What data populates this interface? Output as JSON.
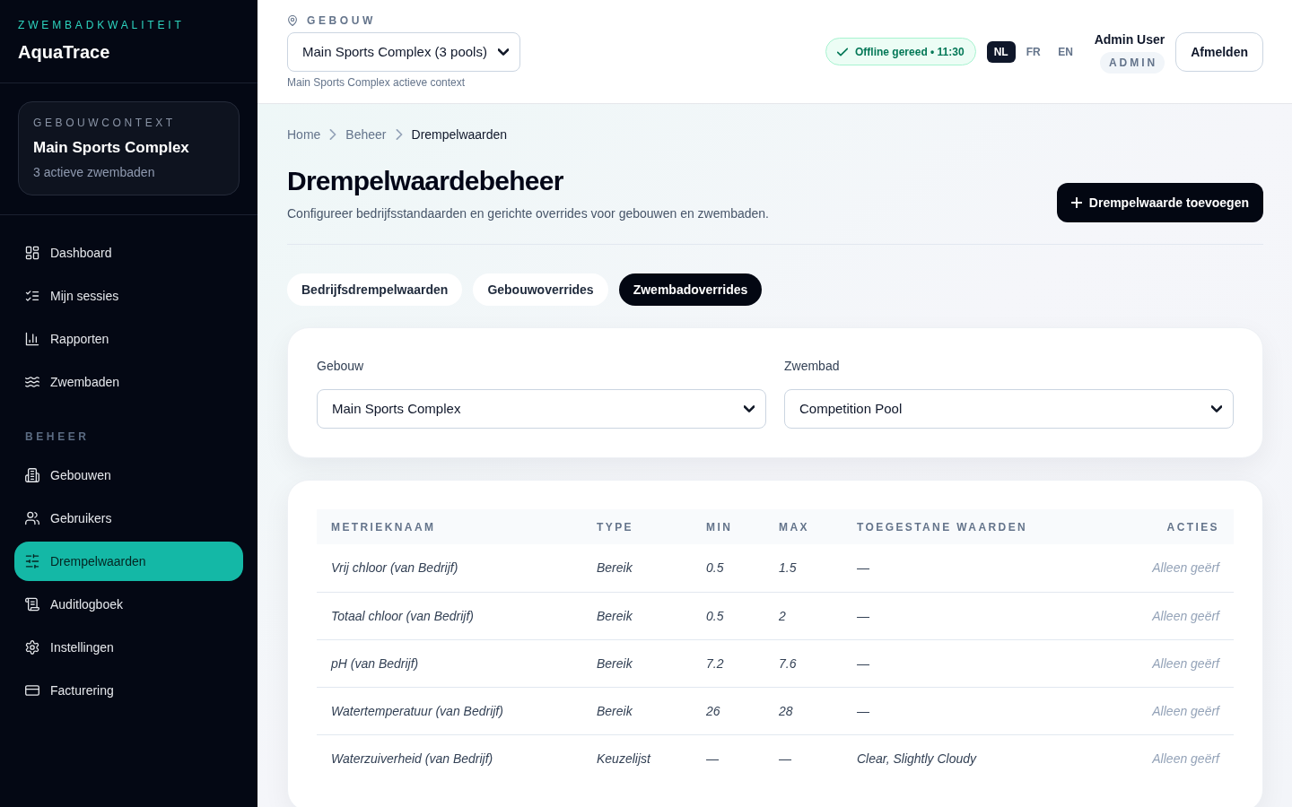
{
  "sidebar": {
    "eyebrow": "ZWEMBADKWALITEIT",
    "brand": "AquaTrace",
    "context_card": {
      "label": "GEBOUWCONTEXT",
      "title": "Main Sports Complex",
      "subtitle": "3 actieve zwembaden"
    },
    "sections": [
      {
        "items": [
          {
            "label": "Dashboard",
            "selected": false
          },
          {
            "label": "Mijn sessies",
            "selected": false
          },
          {
            "label": "Rapporten",
            "selected": false
          },
          {
            "label": "Zwembaden",
            "selected": false
          }
        ]
      },
      {
        "title": "BEHEER",
        "items": [
          {
            "label": "Gebouwen",
            "selected": false
          },
          {
            "label": "Gebruikers",
            "selected": false
          },
          {
            "label": "Drempelwaarden",
            "selected": true
          },
          {
            "label": "Auditlogboek",
            "selected": false
          },
          {
            "label": "Instellingen",
            "selected": false
          },
          {
            "label": "Facturering",
            "selected": false
          }
        ]
      }
    ]
  },
  "header": {
    "building_label": "GEBOUW",
    "building_select": {
      "value": "Main Sports Complex (3 pools)"
    },
    "building_hint": "Main Sports Complex actieve context",
    "sync_badge": "Offline gereed • 11:30",
    "languages": [
      {
        "label": "NL",
        "selected": true
      },
      {
        "label": "FR",
        "selected": false
      },
      {
        "label": "EN",
        "selected": false
      }
    ],
    "user": {
      "name": "Admin User",
      "role": "ADMIN"
    },
    "logout_button": "Afmelden"
  },
  "breadcrumb": [
    "Home",
    "Beheer",
    "Drempelwaarden"
  ],
  "page": {
    "title": "Drempelwaardebeheer",
    "subtitle": "Configureer bedrijfsstandaarden en gerichte overrides voor gebouwen en zwembaden.",
    "add_button": "Drempelwaarde toevoegen"
  },
  "tabs": [
    {
      "label": "Bedrijfsdrempelwaarden",
      "selected": false
    },
    {
      "label": "Gebouwoverrides",
      "selected": false
    },
    {
      "label": "Zwembadoverrides",
      "selected": true
    }
  ],
  "filters": [
    {
      "label": "Gebouw",
      "value": "Main Sports Complex"
    },
    {
      "label": "Zwembad",
      "value": "Competition Pool"
    }
  ],
  "table": {
    "columns": [
      "METRIEKNAAM",
      "TYPE",
      "MIN",
      "MAX",
      "TOEGESTANE WAARDEN",
      "ACTIES"
    ],
    "rows": [
      [
        "Vrij chloor (van Bedrijf)",
        "Bereik",
        "0.5",
        "1.5",
        "—",
        "Alleen geërf"
      ],
      [
        "Totaal chloor (van Bedrijf)",
        "Bereik",
        "0.5",
        "2",
        "—",
        "Alleen geërf"
      ],
      [
        "pH (van Bedrijf)",
        "Bereik",
        "7.2",
        "7.6",
        "—",
        "Alleen geërf"
      ],
      [
        "Watertemperatuur (van Bedrijf)",
        "Bereik",
        "26",
        "28",
        "—",
        "Alleen geërf"
      ],
      [
        "Waterzuiverheid (van Bedrijf)",
        "Keuzelijst",
        "—",
        "—",
        "Clear, Slightly Cloudy",
        "Alleen geërf"
      ]
    ]
  }
}
